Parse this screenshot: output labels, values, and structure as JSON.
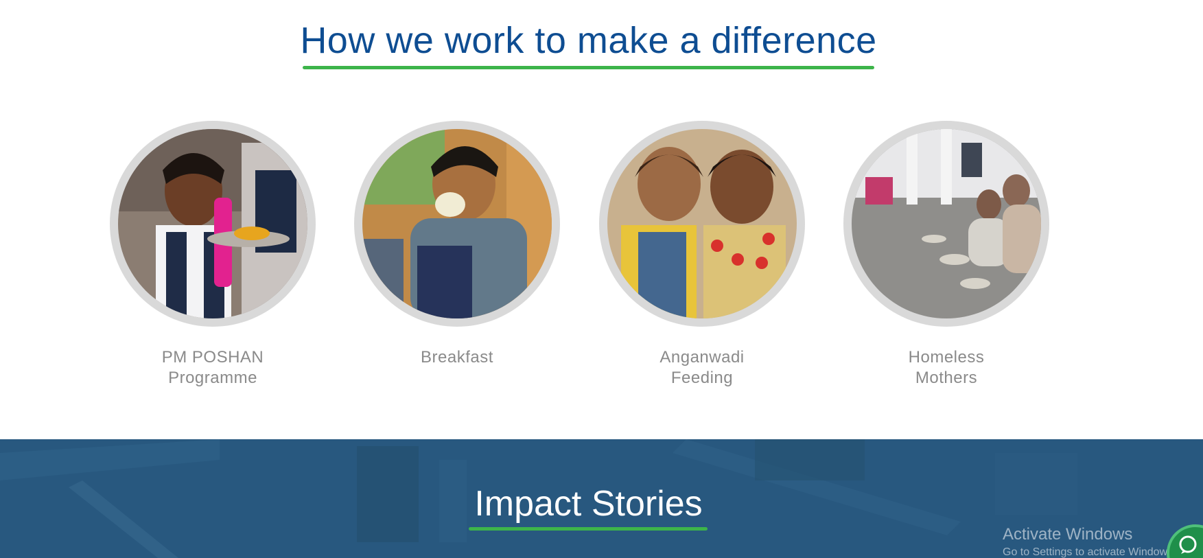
{
  "how_we_work": {
    "title": "How we work to make a difference",
    "programs": [
      {
        "label_line1": "PM POSHAN",
        "label_line2": "Programme"
      },
      {
        "label_line1": "Breakfast",
        "label_line2": ""
      },
      {
        "label_line1": "Anganwadi",
        "label_line2": "Feeding"
      },
      {
        "label_line1": "Homeless",
        "label_line2": "Mothers"
      }
    ]
  },
  "impact": {
    "title": "Impact Stories"
  },
  "windows_watermark": {
    "title": "Activate Windows",
    "subtitle": "Go to Settings to activate Windows."
  },
  "colors": {
    "heading": "#0e4d92",
    "accent_underline": "#3db44a",
    "label": "#8a8a8a",
    "impact_background": "#28587f"
  },
  "icons": {
    "chat": "chat-icon"
  }
}
